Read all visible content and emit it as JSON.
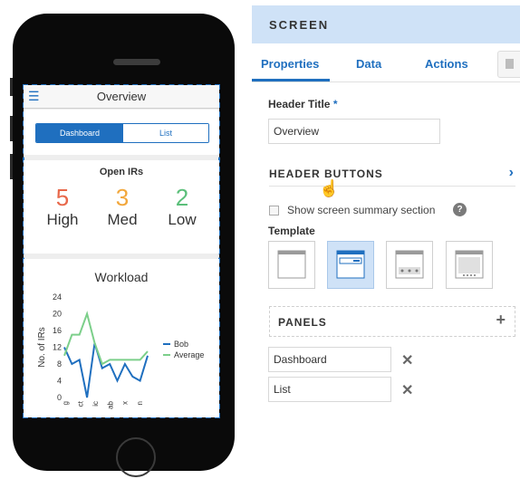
{
  "phone": {
    "header": {
      "menu_icon": "hamburger-icon",
      "title": "Overview"
    },
    "tabs": [
      {
        "label": "Dashboard",
        "active": true
      },
      {
        "label": "List",
        "active": false
      }
    ],
    "open_irs": {
      "title": "Open IRs",
      "items": [
        {
          "value": "5",
          "label": "High",
          "color": "#e8684a"
        },
        {
          "value": "3",
          "label": "Med",
          "color": "#f2a73b"
        },
        {
          "value": "2",
          "label": "Low",
          "color": "#5bbf7a"
        }
      ]
    },
    "workload": {
      "title": "Workload"
    }
  },
  "chart_data": {
    "type": "line",
    "title": "Workload",
    "ylabel": "No. of IRs",
    "xlabel": "",
    "ylim": [
      0,
      24
    ],
    "yticks": [
      0,
      4,
      8,
      12,
      16,
      20,
      24
    ],
    "categories": [
      "g",
      "d",
      "t",
      "c",
      "b",
      "x",
      "n"
    ],
    "x_tick_labels": [
      "g",
      "ct",
      "ic",
      "ab",
      "x",
      "n"
    ],
    "series": [
      {
        "name": "Bob",
        "color": "#1f6fbf",
        "values": [
          12,
          8,
          9,
          0,
          13,
          7,
          8,
          4,
          8,
          5,
          4,
          10
        ]
      },
      {
        "name": "Average",
        "color": "#7ccf8a",
        "values": [
          10,
          15,
          15,
          20,
          13,
          8,
          9,
          9,
          9,
          9,
          9,
          11
        ]
      }
    ],
    "legend": "right"
  },
  "panel": {
    "title": "SCREEN",
    "tabs": [
      {
        "label": "Properties"
      },
      {
        "label": "Data"
      },
      {
        "label": "Actions"
      }
    ],
    "extra_tab_icon": "document-icon",
    "header_title_label": "Header Title",
    "required_mark": "*",
    "header_title_value": "Overview",
    "header_buttons_label": "HEADER BUTTONS",
    "show_summary_label": "Show screen summary section",
    "template_label": "Template",
    "panels_label": "PANELS",
    "panel_items": [
      {
        "value": "Dashboard"
      },
      {
        "value": "List"
      }
    ]
  }
}
